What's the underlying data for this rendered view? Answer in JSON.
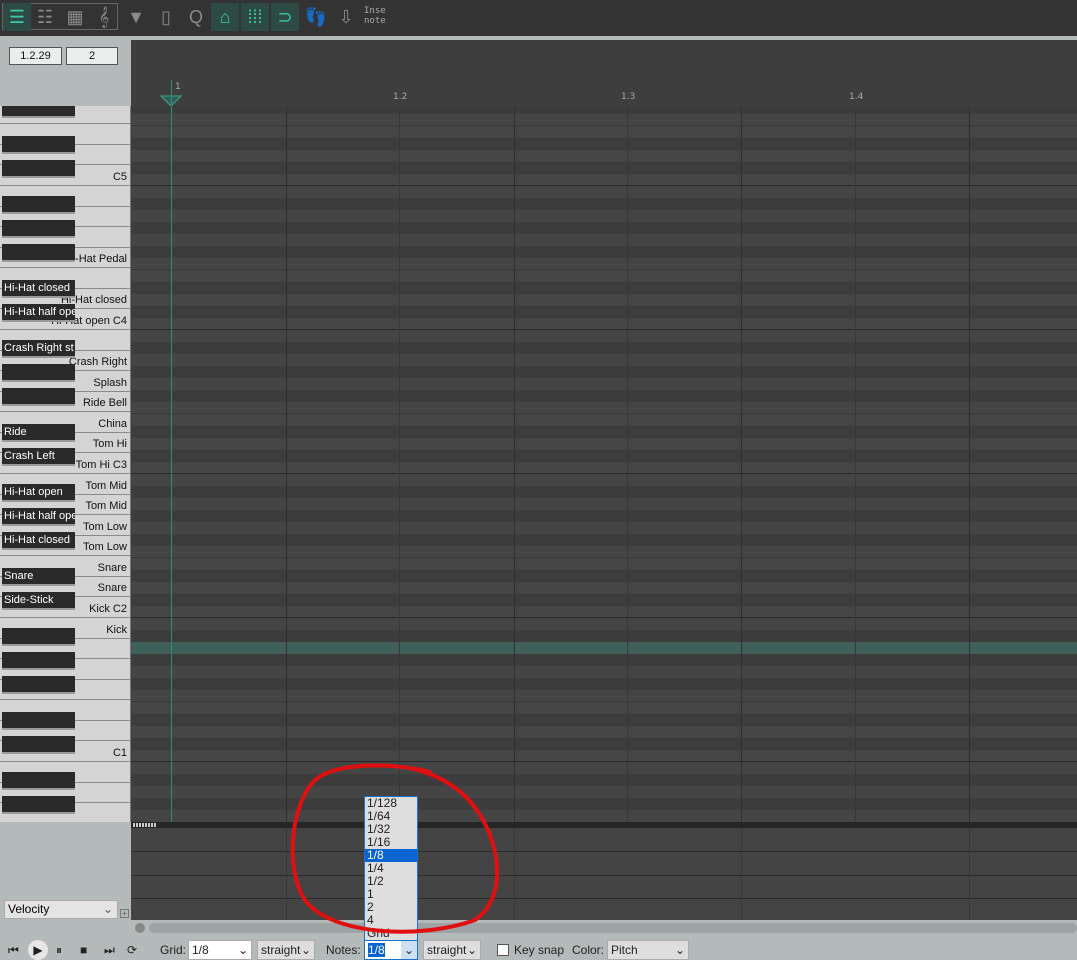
{
  "toolbar": {
    "buttons": [
      {
        "name": "piano-roll-view-icon",
        "on": true
      },
      {
        "name": "named-notes-view-icon"
      },
      {
        "name": "event-list-view-icon"
      },
      {
        "name": "notation-view-icon"
      },
      {
        "name": "filter-icon"
      },
      {
        "name": "media-window-icon"
      },
      {
        "name": "quantize-icon"
      },
      {
        "name": "cc-link-icon",
        "on": true
      },
      {
        "name": "snap-grid-icon",
        "on": true
      },
      {
        "name": "snap-magnet-icon",
        "on": true
      },
      {
        "name": "step-input-icon"
      },
      {
        "name": "insert-note-icon"
      }
    ],
    "insert_label_1": "Inse",
    "insert_label_2": "note"
  },
  "position": {
    "time": "1.2.29",
    "length": "2"
  },
  "ruler": {
    "markers": [
      "1",
      "1.2",
      "1.3",
      "1.4"
    ]
  },
  "keyboard": {
    "lowest_pitch": 19,
    "highest_pitch": 78,
    "selected_pitch": 33,
    "labels": {
      "72": "C5",
      "65": "Hi-Hat Pedal",
      "63": "Hi-Hat closed",
      "62": "Hi-Hat closed",
      "61": "Hi-Hat half ope",
      "60": "Hi-Hat open   C4",
      "58": "Crash Right st",
      "57": "Crash Right",
      "55": "Splash",
      "53": "Ride Bell",
      "52": "China",
      "51": "Ride",
      "50": "Tom Hi",
      "49": "Crash Left",
      "48": "Tom Hi   C3",
      "47": "Tom Mid",
      "46": "Hi-Hat open",
      "45": "Tom Mid",
      "44": "Hi-Hat half ope",
      "43": "Tom Low",
      "42": "Hi-Hat closed",
      "41": "Tom Low",
      "40": "Snare",
      "39": "Snare",
      "38": "Snare",
      "37": "Side-Stick",
      "36": "Kick   C2",
      "35": "Kick",
      "24": "C1"
    }
  },
  "lane": {
    "selected": "Velocity"
  },
  "bottom": {
    "grid_label": "Grid:",
    "grid_value": "1/8",
    "grid_swing": "straight",
    "notes_label": "Notes:",
    "notes_value": "1/8",
    "notes_swing": "straight",
    "keysnap_label": "Key snap",
    "keysnap_checked": false,
    "color_label": "Color:",
    "color_value": "Pitch"
  },
  "notes_dropdown": {
    "options": [
      "1/128",
      "1/64",
      "1/32",
      "1/16",
      "1/8",
      "1/4",
      "1/2",
      "1",
      "2",
      "4",
      "Grid"
    ],
    "selected": "1/8"
  },
  "colors": {
    "accent": "#3fc9a6",
    "selected_row": "#3f5f5a",
    "annotation": "#e01010"
  }
}
